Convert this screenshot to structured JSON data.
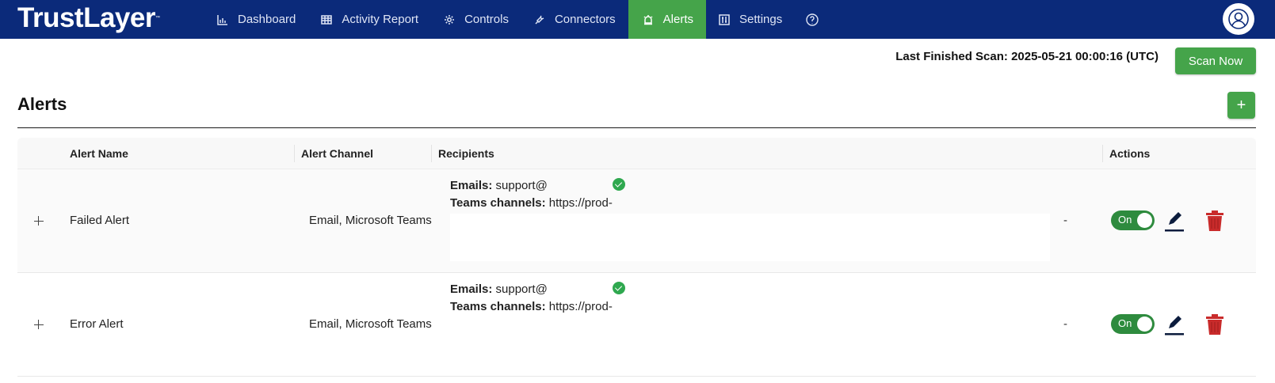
{
  "brand": {
    "name": "TrustLayer",
    "mark": "™"
  },
  "nav": {
    "items": [
      {
        "label": "Dashboard",
        "icon": "bar-chart-icon"
      },
      {
        "label": "Activity Report",
        "icon": "table-icon"
      },
      {
        "label": "Controls",
        "icon": "gear-icon"
      },
      {
        "label": "Connectors",
        "icon": "plug-icon"
      },
      {
        "label": "Alerts",
        "icon": "alarm-icon",
        "active": true
      },
      {
        "label": "Settings",
        "icon": "sliders-icon"
      }
    ],
    "help_icon": "help-circle-icon",
    "avatar_icon": "user-icon"
  },
  "scan": {
    "last_finished": "Last Finished Scan: 2025-05-21 00:00:16 (UTC)",
    "button": "Scan Now"
  },
  "page": {
    "title": "Alerts",
    "add_button": "+"
  },
  "table": {
    "headers": {
      "name": "Alert Name",
      "channel": "Alert Channel",
      "recipients": "Recipients",
      "actions": "Actions"
    },
    "rows": [
      {
        "name": "Failed Alert",
        "channel": "Email, Microsoft Teams",
        "emails_label": "Emails:",
        "emails_value": "support@",
        "teams_label": "Teams channels:",
        "teams_value": "https://prod-",
        "trailing": "-",
        "toggle": "On"
      },
      {
        "name": "Error Alert",
        "channel": "Email, Microsoft Teams",
        "emails_label": "Emails:",
        "emails_value": "support@",
        "teams_label": "Teams channels:",
        "teams_value": "https://prod-",
        "trailing": "-",
        "toggle": "On"
      }
    ]
  },
  "colors": {
    "navbar": "#0b2a7a",
    "accent": "#45a44a",
    "toggle_on": "#2e8b3e",
    "delete": "#c92b2b",
    "verified": "#2fa84f"
  }
}
